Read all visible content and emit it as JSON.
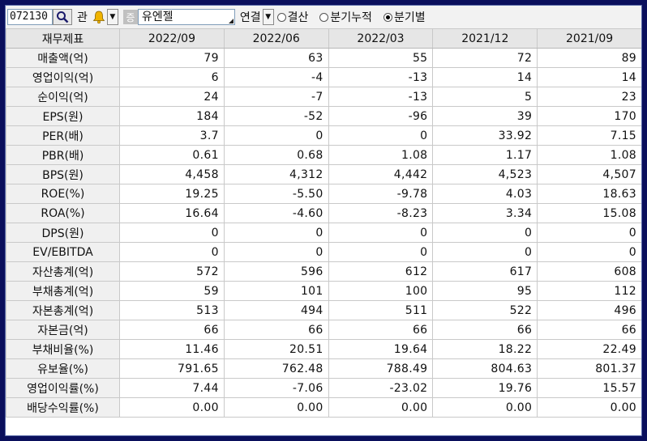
{
  "toolbar": {
    "code": "072130",
    "gwan": "관",
    "jeung": "증",
    "company": "유엔젤",
    "consolidation": "연결",
    "radios": [
      {
        "label": "결산",
        "checked": false
      },
      {
        "label": "분기누적",
        "checked": false
      },
      {
        "label": "분기별",
        "checked": true
      }
    ]
  },
  "table": {
    "corner": "재무제표",
    "periods": [
      "2022/09",
      "2022/06",
      "2022/03",
      "2021/12",
      "2021/09"
    ],
    "rows": [
      {
        "label": "매출액(억)",
        "values": [
          "79",
          "63",
          "55",
          "72",
          "89"
        ]
      },
      {
        "label": "영업이익(억)",
        "values": [
          "6",
          "-4",
          "-13",
          "14",
          "14"
        ]
      },
      {
        "label": "순이익(억)",
        "values": [
          "24",
          "-7",
          "-13",
          "5",
          "23"
        ]
      },
      {
        "label": "EPS(원)",
        "values": [
          "184",
          "-52",
          "-96",
          "39",
          "170"
        ]
      },
      {
        "label": "PER(배)",
        "values": [
          "3.7",
          "0",
          "0",
          "33.92",
          "7.15"
        ]
      },
      {
        "label": "PBR(배)",
        "values": [
          "0.61",
          "0.68",
          "1.08",
          "1.17",
          "1.08"
        ]
      },
      {
        "label": "BPS(원)",
        "values": [
          "4,458",
          "4,312",
          "4,442",
          "4,523",
          "4,507"
        ]
      },
      {
        "label": "ROE(%)",
        "values": [
          "19.25",
          "-5.50",
          "-9.78",
          "4.03",
          "18.63"
        ]
      },
      {
        "label": "ROA(%)",
        "values": [
          "16.64",
          "-4.60",
          "-8.23",
          "3.34",
          "15.08"
        ]
      },
      {
        "label": "DPS(원)",
        "values": [
          "0",
          "0",
          "0",
          "0",
          "0"
        ]
      },
      {
        "label": "EV/EBITDA",
        "values": [
          "0",
          "0",
          "0",
          "0",
          "0"
        ]
      },
      {
        "label": "자산총계(억)",
        "values": [
          "572",
          "596",
          "612",
          "617",
          "608"
        ]
      },
      {
        "label": "부채총계(억)",
        "values": [
          "59",
          "101",
          "100",
          "95",
          "112"
        ]
      },
      {
        "label": "자본총계(억)",
        "values": [
          "513",
          "494",
          "511",
          "522",
          "496"
        ]
      },
      {
        "label": "자본금(억)",
        "values": [
          "66",
          "66",
          "66",
          "66",
          "66"
        ]
      },
      {
        "label": "부채비율(%)",
        "values": [
          "11.46",
          "20.51",
          "19.64",
          "18.22",
          "22.49"
        ]
      },
      {
        "label": "유보율(%)",
        "values": [
          "791.65",
          "762.48",
          "788.49",
          "804.63",
          "801.37"
        ]
      },
      {
        "label": "영업이익률(%)",
        "values": [
          "7.44",
          "-7.06",
          "-23.02",
          "19.76",
          "15.57"
        ]
      },
      {
        "label": "배당수익률(%)",
        "values": [
          "0.00",
          "0.00",
          "0.00",
          "0.00",
          "0.00"
        ]
      }
    ]
  }
}
